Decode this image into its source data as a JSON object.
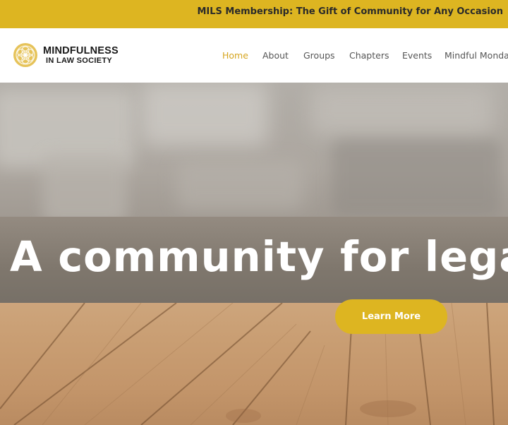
{
  "topbar": {
    "announcement": "MILS Membership: The Gift of Community for Any Occasion",
    "color": "#ddb521"
  },
  "header": {
    "logo": {
      "line1": "MINDFULNESS",
      "line2": "IN LAW SOCIETY",
      "icon": "mandala-icon"
    },
    "nav": [
      {
        "label": "Home",
        "active": true
      },
      {
        "label": "About",
        "active": false
      },
      {
        "label": "Groups",
        "active": false
      },
      {
        "label": "Chapters",
        "active": false
      },
      {
        "label": "Events",
        "active": false
      },
      {
        "label": "Mindful Monday",
        "active": false
      }
    ],
    "active_color": "#d6a51f"
  },
  "hero": {
    "title": "A community for legal p",
    "cta_label": "Learn More",
    "cta_color": "#ddb521"
  }
}
